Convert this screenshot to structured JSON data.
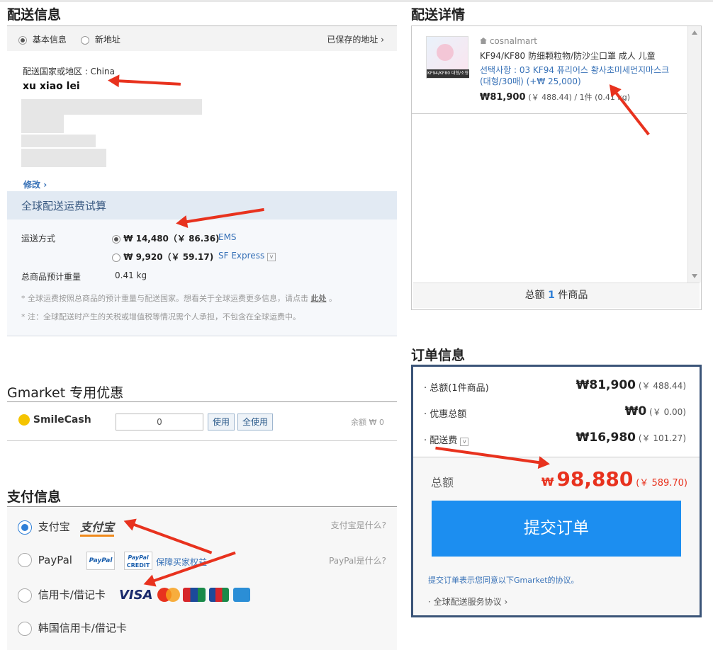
{
  "shipping_info": {
    "title": "配送信息",
    "tab_basic": "基本信息",
    "tab_new": "新地址",
    "saved_link": "已保存的地址",
    "country_label": "配送国家或地区 : China",
    "name": "xu xiao lei",
    "edit_link": "修改",
    "calc_title": "全球配送运费试算",
    "method_label": "运送方式",
    "option1_price": "₩ 14,480（￥ 86.36)",
    "option1_carrier": "EMS",
    "option2_price": "₩ 9,920（￥ 59.17)",
    "option2_carrier": "SF Express",
    "weight_label": "总商品预计重量",
    "weight_value": "0.41 kg",
    "note1_prefix": "* 全球运费按照总商品的预计重量与配送国家。想看关于全球运费更多信息，请点击",
    "note1_link": "此处",
    "note1_suffix": "。",
    "note2": "* 注：全球配送时产生的关税或增值税等情况需个人承担，不包含在全球运费中。"
  },
  "discount": {
    "title": "Gmarket 专用优惠",
    "smilecash_logo": "SmileCash",
    "input_value": "0",
    "use_btn": "使用",
    "use_all_btn": "全使用",
    "balance": "余额 ₩ 0"
  },
  "payment": {
    "title": "支付信息",
    "alipay_label": "支付宝",
    "alipay_logo": "支付宝",
    "alipay_help": "支付宝是什么?",
    "paypal_label": "PayPal",
    "paypal_logo": "PayPal",
    "paypal_credit_logo1": "PayPal",
    "paypal_credit_logo2": "CREDIT",
    "paypal_protect": "保障买家权益",
    "paypal_help": "PayPal是什么?",
    "card_label": "信用卡/借记卡",
    "visa": "VISA",
    "korea_card_label": "韩国信用卡/借记卡"
  },
  "detail": {
    "title": "配送详情",
    "seller": "cosnalmart",
    "thumb_caption": "KF94/KF80 대형/소형",
    "product_name": "KF94/KF80 防细颗粒物/防沙尘口罩 成人 儿童",
    "option_line1": "선택사항 : 03 KF94 퓨리어스 황사초미세먼지마스크",
    "option_line2": "(대형/30매) (+₩ 25,000)",
    "price": "₩81,900",
    "price_sub": "(￥ 488.44) / 1件 (0.41 kg)",
    "total_prefix": "总额 ",
    "total_count": "1",
    "total_suffix": " 件商品"
  },
  "order": {
    "title": "订单信息",
    "subtotal_label": "· 总额(1件商品)",
    "subtotal_value": "₩81,900",
    "subtotal_cny": "(￥ 488.44)",
    "discount_label": "· 优惠总额",
    "discount_value": "₩0",
    "discount_cny": "(￥ 0.00)",
    "shipping_label": "· 配送费",
    "shipping_value": "₩16,980",
    "shipping_cny": "(￥ 101.27)",
    "total_label": "总额",
    "total_currency": "₩",
    "total_value": "98,880",
    "total_cny": "(￥ 589.70)",
    "submit_label": "提交订单",
    "agree_text": "提交订单表示您同意以下Gmarket的协议。",
    "service_link": "· 全球配送服务协议"
  },
  "colors": {
    "accent": "#1c8ef0",
    "price_red": "#e8321e",
    "link_blue": "#3771b7"
  }
}
